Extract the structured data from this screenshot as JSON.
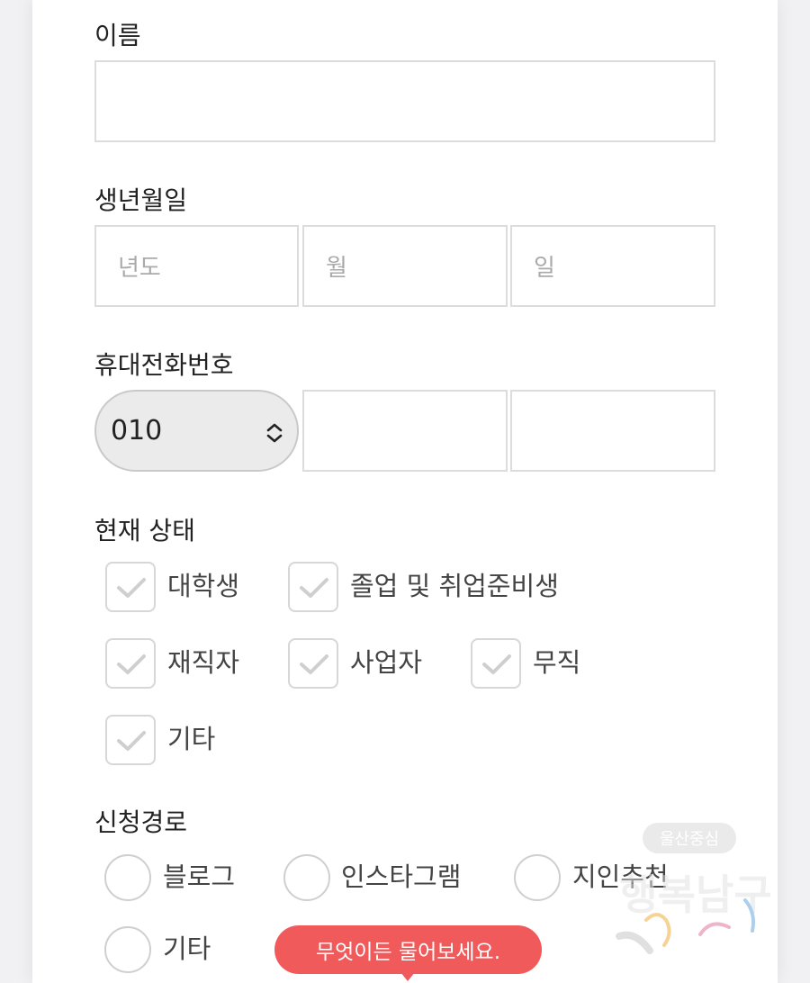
{
  "form": {
    "name": {
      "label": "이름",
      "value": ""
    },
    "birth": {
      "label": "생년월일",
      "year_placeholder": "년도",
      "month_placeholder": "월",
      "day_placeholder": "일"
    },
    "phone": {
      "label": "휴대전화번호",
      "prefix": "010",
      "middle": "",
      "last": ""
    },
    "status": {
      "label": "현재 상태",
      "options": [
        "대학생",
        "졸업 및 취업준비생",
        "재직자",
        "사업자",
        "무직",
        "기타"
      ]
    },
    "source": {
      "label": "신청경로",
      "options": [
        "블로그",
        "인스타그램",
        "지인추천",
        "기타"
      ]
    }
  },
  "watermark": {
    "top_text": "울산중심",
    "main_text": "행복남구"
  },
  "chat_button": {
    "label": "무엇이든 물어보세요."
  },
  "colors": {
    "accent": "#f15a5a",
    "border": "#dcdcdc",
    "select_bg": "#ebebeb"
  },
  "icons": {
    "select": "chevron-updown-icon",
    "checkbox": "check-icon"
  }
}
